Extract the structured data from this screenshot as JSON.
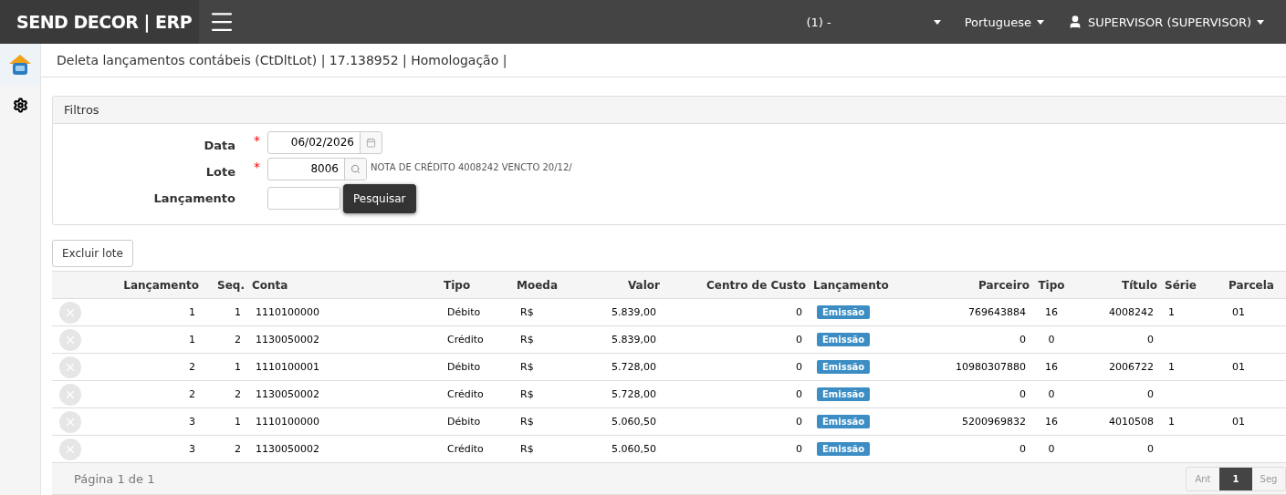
{
  "brand": "SEND DECOR | ERP",
  "topbar": {
    "company": "(1) -",
    "language": "Portuguese",
    "user": "SUPERVISOR (SUPERVISOR)"
  },
  "page_title": "Deleta lançamentos contábeis (CtDltLot) | 17.138952 | Homologação |",
  "filters": {
    "title": "Filtros",
    "required_mark": "*",
    "fields": [
      {
        "label": "Data",
        "required": true,
        "value": "06/02/2026",
        "kind": "date"
      },
      {
        "label": "Lote",
        "required": true,
        "value": "8006",
        "kind": "lookup",
        "description": "NOTA DE CRÉDITO 4008242 VENCTO 20/12/"
      },
      {
        "label": "Lançamento",
        "required": false,
        "kind": "search",
        "button": "Pesquisar"
      }
    ]
  },
  "delete_button": "Excluir lote",
  "table": {
    "columns": [
      "Lançamento",
      "Seq.",
      "Conta",
      "Tipo",
      "Moeda",
      "Valor",
      "Centro de Custo",
      "Lançamento",
      "Parceiro",
      "Tipo",
      "Título",
      "Série",
      "Parcela"
    ],
    "rows": [
      {
        "cells": [
          "1",
          "1",
          "1110100000",
          "Débito",
          "R$",
          "5.839,00",
          "0",
          "Emissão",
          "769643884",
          "16",
          "4008242",
          "1",
          "01"
        ]
      },
      {
        "cells": [
          "1",
          "2",
          "1130050002",
          "Crédito",
          "R$",
          "5.839,00",
          "0",
          "Emissão",
          "0",
          "0",
          "0",
          "",
          ""
        ]
      },
      {
        "cells": [
          "2",
          "1",
          "1110100001",
          "Débito",
          "R$",
          "5.728,00",
          "0",
          "Emissão",
          "10980307880",
          "16",
          "2006722",
          "1",
          "01"
        ]
      },
      {
        "cells": [
          "2",
          "2",
          "1130050002",
          "Crédito",
          "R$",
          "5.728,00",
          "0",
          "Emissão",
          "0",
          "0",
          "0",
          "",
          ""
        ]
      },
      {
        "cells": [
          "3",
          "1",
          "1110100000",
          "Débito",
          "R$",
          "5.060,50",
          "0",
          "Emissão",
          "5200969832",
          "16",
          "4010508",
          "1",
          "01"
        ]
      },
      {
        "cells": [
          "3",
          "2",
          "1130050002",
          "Crédito",
          "R$",
          "5.060,50",
          "0",
          "Emissão",
          "0",
          "0",
          "0",
          "",
          ""
        ]
      }
    ]
  },
  "pagination": {
    "summary": "Página 1 de 1",
    "prev": "Ant",
    "next": "Seg",
    "pages": [
      {
        "label": "1",
        "selected": true
      }
    ]
  }
}
